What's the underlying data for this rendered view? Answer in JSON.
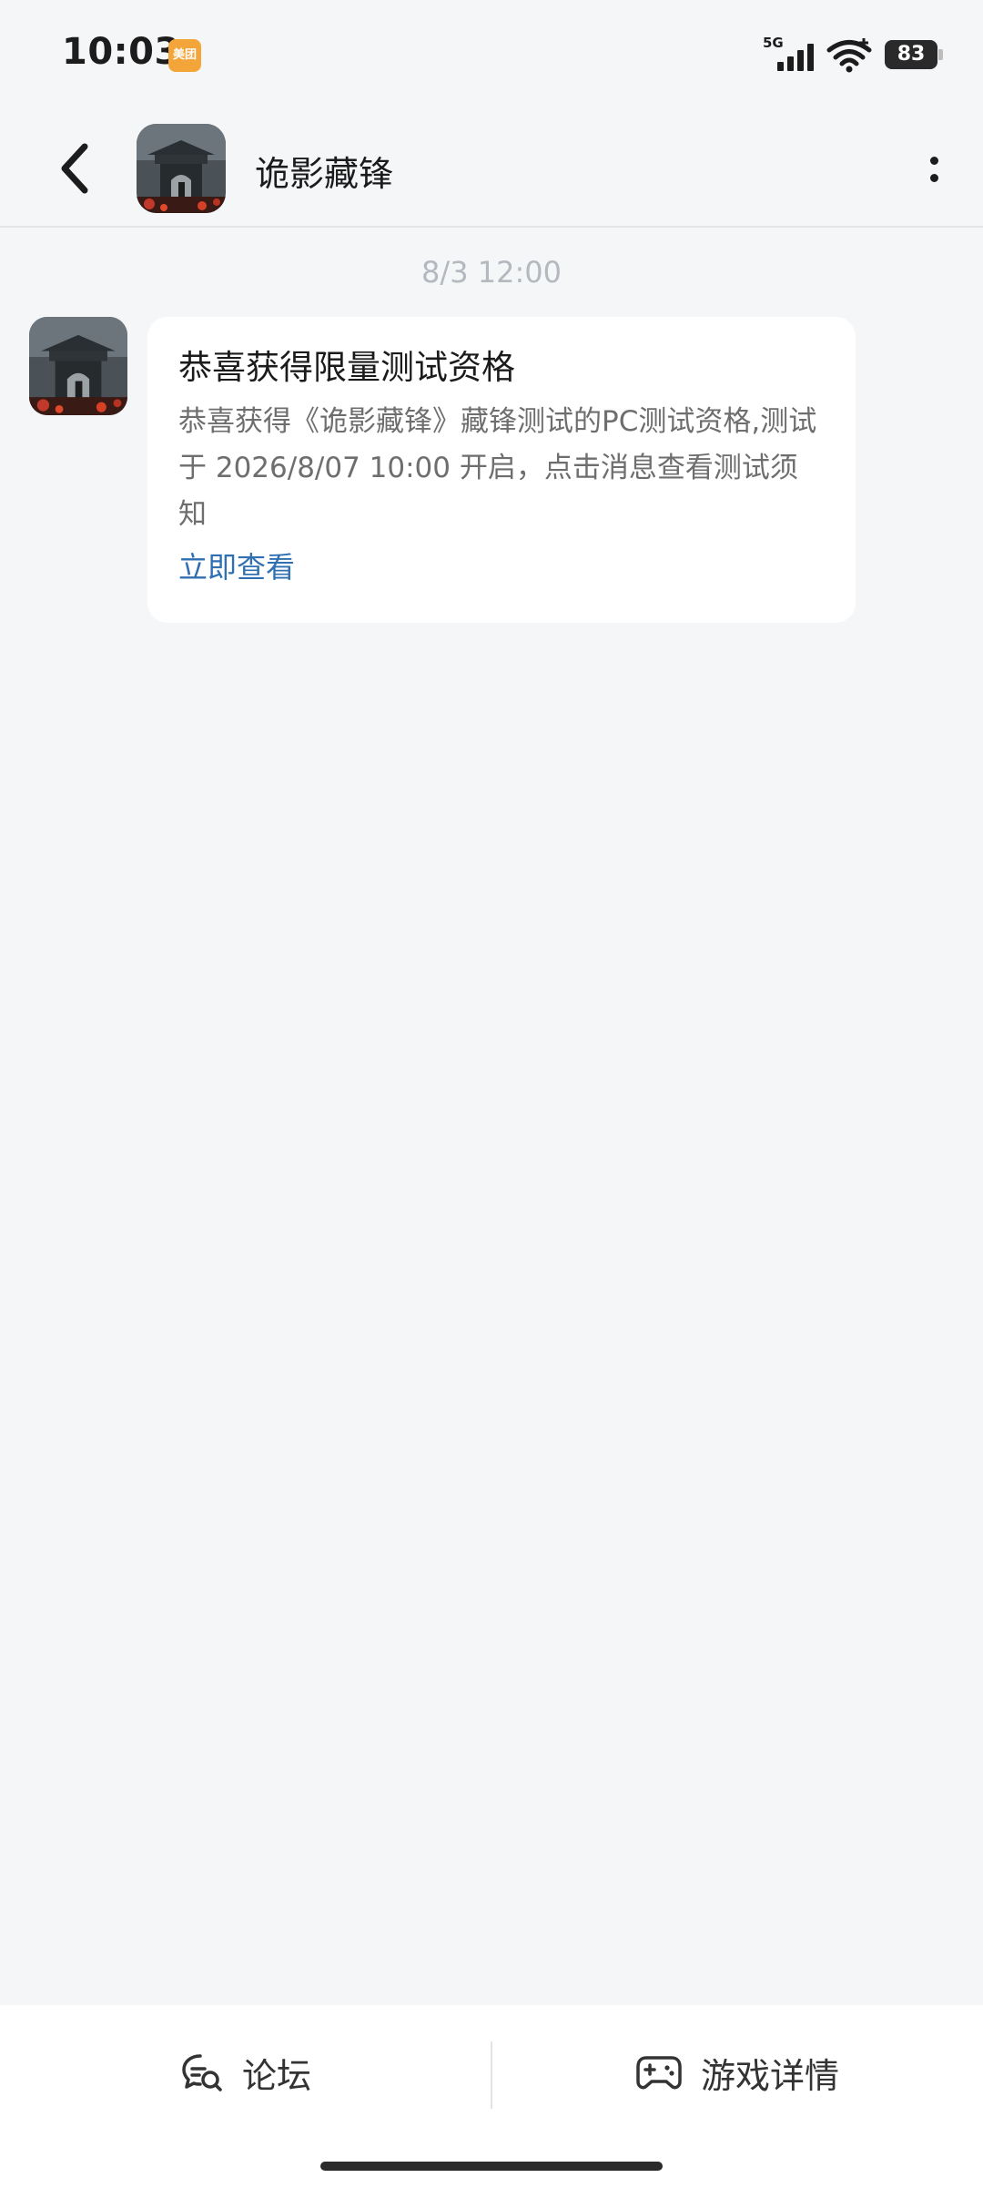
{
  "status_bar": {
    "time": "10:03",
    "app_badge": "美团",
    "network": "5G",
    "battery": "83"
  },
  "header": {
    "title": "诡影藏锋"
  },
  "chat": {
    "timestamp": "8/3  12:00",
    "message": {
      "title": "恭喜获得限量测试资格",
      "body": "恭喜获得《诡影藏锋》藏锋测试的PC测试资格,测试于 2026/8/07 10:00 开启，点击消息查看测试须知",
      "link": "立即查看"
    }
  },
  "bottom_bar": {
    "forum_label": "论坛",
    "game_details_label": "游戏详情"
  },
  "colors": {
    "background": "#f5f6f8",
    "card": "#ffffff",
    "link": "#2f6fb2",
    "timestamp": "#b4b8bf"
  }
}
